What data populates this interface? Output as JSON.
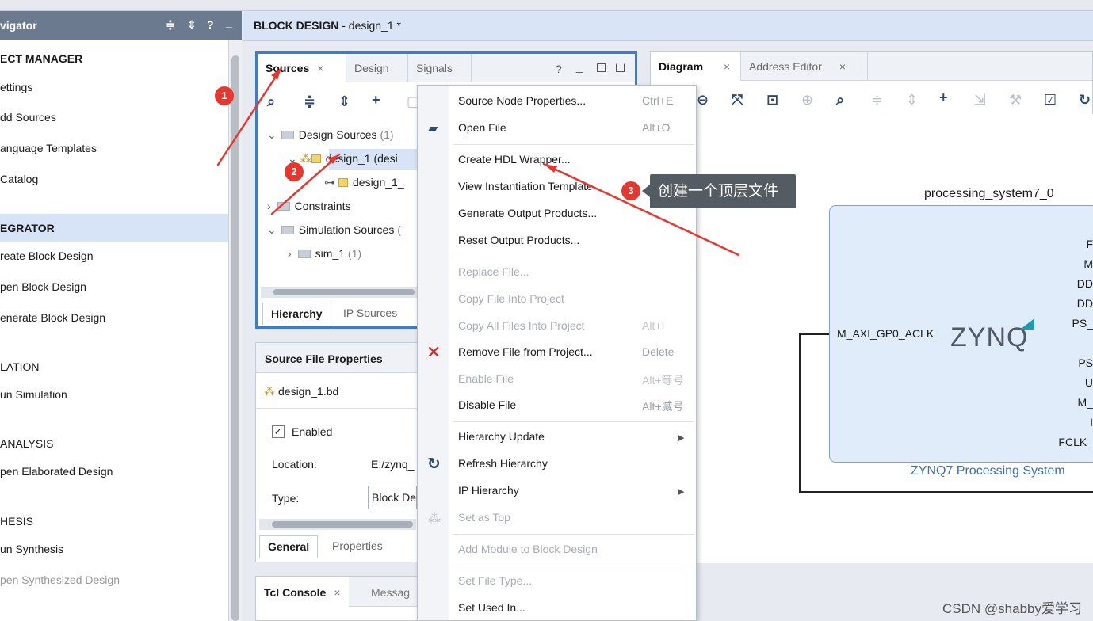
{
  "navigator": {
    "title": "vigator",
    "header_icons": [
      "collapse-icon",
      "expand-icon",
      "help-icon",
      "minimize-icon"
    ],
    "help_glyph": "?",
    "minimize_glyph": "_",
    "sections": [
      {
        "label": "ECT MANAGER",
        "items": [
          "ettings",
          "dd Sources",
          "anguage Templates",
          " Catalog"
        ]
      },
      {
        "label": "EGRATOR",
        "items": [
          "reate Block Design",
          "pen Block Design",
          "enerate Block Design"
        ]
      },
      {
        "label": "LATION",
        "items": [
          "un Simulation"
        ]
      },
      {
        "label": "ANALYSIS",
        "items": [
          "pen Elaborated Design"
        ]
      },
      {
        "label": "HESIS",
        "items": [
          "un Synthesis",
          "pen Synthesized Design"
        ]
      }
    ]
  },
  "block_design": {
    "title_prefix": "BLOCK DESIGN",
    "title_suffix": " - design_1 *"
  },
  "sources_panel": {
    "tabs": [
      {
        "label": "Sources",
        "close": "×"
      },
      {
        "label": "Design"
      },
      {
        "label": "Signals"
      }
    ],
    "win_controls": [
      "?",
      "_"
    ],
    "tree": [
      {
        "label": "Design Sources",
        "count": "(1)"
      },
      {
        "label": "design_1 (desi"
      },
      {
        "label": "design_1_"
      },
      {
        "label": "Constraints"
      },
      {
        "label": "Simulation Sources",
        "count": "("
      },
      {
        "label": "sim_1",
        "count": "(1)"
      }
    ],
    "bottom_tabs": [
      "Hierarchy",
      "IP Sources"
    ]
  },
  "properties_panel": {
    "title": "Source File Properties",
    "file": "design_1.bd",
    "enabled_label": "Enabled",
    "enabled": true,
    "location_label": "Location:",
    "location_value": "E:/zynq_",
    "type_label": "Type:",
    "type_value": "Block De",
    "bottom_tabs": [
      "General",
      "Properties"
    ]
  },
  "tcl_panel": {
    "tabs": [
      "Tcl Console",
      "Messag"
    ],
    "close": "×"
  },
  "diagram_panel": {
    "tabs": [
      {
        "label": "Diagram",
        "close": "×"
      },
      {
        "label": "Address Editor",
        "close": "×"
      }
    ],
    "instance_name": "processing_system7_0",
    "port_left": "M_AXI_GP0_ACLK",
    "logo": "ZYNQ",
    "caption": "ZYNQ7 Processing System",
    "ports_right": [
      "F",
      "M",
      "DD",
      "DD",
      "PS_",
      "PS",
      "U",
      "M_",
      "I",
      "FCLK_"
    ]
  },
  "context_menu": {
    "items": [
      {
        "label": "Source Node Properties...",
        "shortcut": "Ctrl+E",
        "enabled": true
      },
      {
        "label": "Open File",
        "shortcut": "Alt+O",
        "enabled": true,
        "icon": "folder-open-icon"
      },
      {
        "label": "Create HDL Wrapper...",
        "enabled": true
      },
      {
        "label": "View Instantiation Template",
        "enabled": true
      },
      {
        "label": "Generate Output Products...",
        "enabled": true
      },
      {
        "label": "Reset Output Products...",
        "enabled": true
      },
      {
        "label": "Replace File...",
        "enabled": false
      },
      {
        "label": "Copy File Into Project",
        "enabled": false
      },
      {
        "label": "Copy All Files Into Project",
        "shortcut": "Alt+I",
        "enabled": false
      },
      {
        "label": "Remove File from Project...",
        "shortcut": "Delete",
        "enabled": true,
        "icon": "delete-x-icon"
      },
      {
        "label": "Enable File",
        "shortcut": "Alt+等号",
        "enabled": false
      },
      {
        "label": "Disable File",
        "shortcut": "Alt+减号",
        "enabled": true
      },
      {
        "label": "Hierarchy Update",
        "submenu": true,
        "enabled": true
      },
      {
        "label": "Refresh Hierarchy",
        "enabled": true,
        "icon": "refresh-icon"
      },
      {
        "label": "IP Hierarchy",
        "submenu": true,
        "enabled": true
      },
      {
        "label": "Set as Top",
        "enabled": false,
        "icon": "hierarchy-icon"
      },
      {
        "label": "Add Module to Block Design",
        "enabled": false
      },
      {
        "label": "Set File Type...",
        "enabled": false
      },
      {
        "label": "Set Used In...",
        "enabled": true
      }
    ]
  },
  "annotations": {
    "badges": [
      "1",
      "2",
      "3"
    ],
    "tooltip": "创建一个顶层文件",
    "arrow_color": "#e8362f"
  },
  "watermark": "CSDN @shabby爱学习"
}
